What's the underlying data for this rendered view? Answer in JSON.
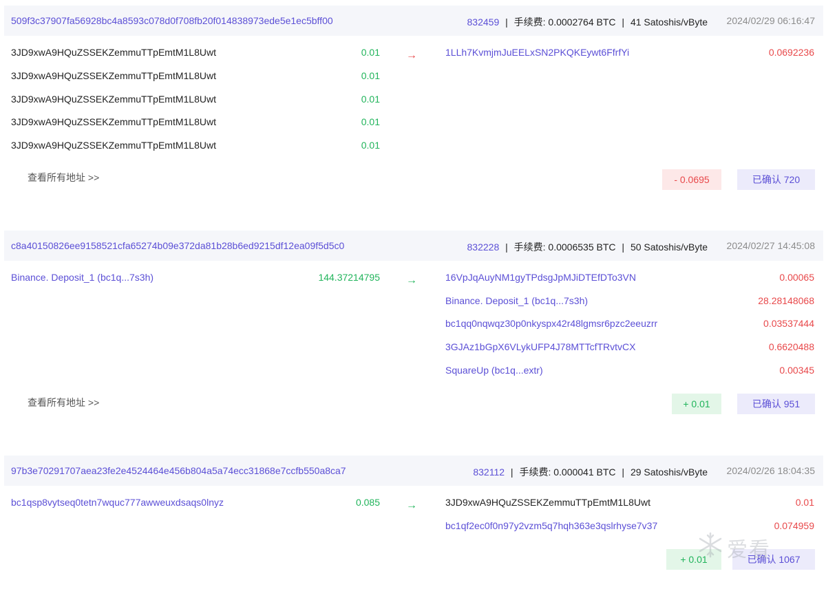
{
  "tx1": {
    "txid": "509f3c37907fa56928bc4a8593c078d0f708fb20f014838973ede5e1ec5bff00",
    "block": "832459",
    "fee_label": "手续费: 0.0002764 BTC",
    "rate": "41 Satoshis/vByte",
    "time": "2024/02/29 06:16:47",
    "inputs": [
      {
        "address": "3JD9xwA9HQuZSSEKZemmuTTpEmtM1L8Uwt",
        "amount": "0.01"
      },
      {
        "address": "3JD9xwA9HQuZSSEKZemmuTTpEmtM1L8Uwt",
        "amount": "0.01"
      },
      {
        "address": "3JD9xwA9HQuZSSEKZemmuTTpEmtM1L8Uwt",
        "amount": "0.01"
      },
      {
        "address": "3JD9xwA9HQuZSSEKZemmuTTpEmtM1L8Uwt",
        "amount": "0.01"
      },
      {
        "address": "3JD9xwA9HQuZSSEKZemmuTTpEmtM1L8Uwt",
        "amount": "0.01"
      }
    ],
    "outputs": [
      {
        "address": "1LLh7KvmjmJuEELxSN2PKQKEywt6FfrfYi",
        "amount": "0.0692236"
      }
    ],
    "view_all": "查看所有地址 >>",
    "net": "- 0.0695",
    "confirm": "已确认 720",
    "arrow": "→"
  },
  "tx2": {
    "txid": "c8a40150826ee9158521cfa65274b09e372da81b28b6ed9215df12ea09f5d5c0",
    "block": "832228",
    "fee_label": "手续费: 0.0006535 BTC",
    "rate": "50 Satoshis/vByte",
    "time": "2024/02/27 14:45:08",
    "inputs": [
      {
        "address": "Binance. Deposit_1 (bc1q...7s3h)",
        "amount": "144.37214795"
      }
    ],
    "outputs": [
      {
        "address": "16VpJqAuyNM1gyTPdsgJpMJiDTEfDTo3VN",
        "amount": "0.00065"
      },
      {
        "address": "Binance. Deposit_1 (bc1q...7s3h)",
        "amount": "28.28148068"
      },
      {
        "address": "bc1qq0nqwqz30p0nkyspx42r48lgmsr6pzc2eeuzrr",
        "amount": "0.03537444"
      },
      {
        "address": "3GJAz1bGpX6VLykUFP4J78MTTcfTRvtvCX",
        "amount": "0.6620488"
      },
      {
        "address": "SquareUp (bc1q...extr)",
        "amount": "0.00345"
      }
    ],
    "view_all": "查看所有地址 >>",
    "net": "+ 0.01",
    "confirm": "已确认 951",
    "arrow": "→"
  },
  "tx3": {
    "txid": "97b3e70291707aea23fe2e4524464e456b804a5a74ecc31868e7ccfb550a8ca7",
    "block": "832112",
    "fee_label": "手续费: 0.000041 BTC",
    "rate": "29 Satoshis/vByte",
    "time": "2024/02/26 18:04:35",
    "inputs": [
      {
        "address": "bc1qsp8vytseq0tetn7wquc777awweuxdsaqs0lnyz",
        "amount": "0.085"
      }
    ],
    "outputs": [
      {
        "address": "3JD9xwA9HQuZSSEKZemmuTTpEmtM1L8Uwt",
        "amount": "0.01"
      },
      {
        "address": "bc1qf2ec0f0n97y2vzm5q7hqh363e3qslrhyse7v37",
        "amount": "0.074959"
      }
    ],
    "net": "+ 0.01",
    "confirm": "已确认 1067",
    "arrow": "→"
  },
  "separator": "|",
  "watermark": "爱看",
  "colors": {
    "accent": "#5b4fd6",
    "positive": "#21b45b",
    "negative": "#e8484a"
  }
}
